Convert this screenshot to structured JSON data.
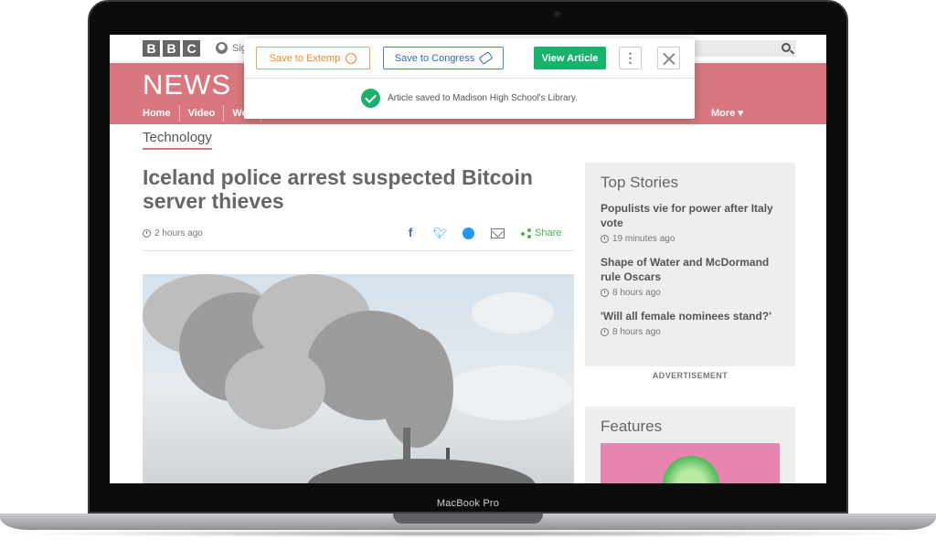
{
  "device": {
    "label": "MacBook Pro"
  },
  "site": {
    "logo_letters": [
      "B",
      "B",
      "C"
    ],
    "sign_in": "Sig",
    "section_title": "NEWS",
    "nav": [
      "Home",
      "Video",
      "Wor"
    ],
    "nav_more": "More ▾"
  },
  "article": {
    "section": "Technology",
    "headline": "Iceland police arrest suspected Bitcoin server thieves",
    "time": "2 hours ago",
    "share_label": "Share"
  },
  "sidebar": {
    "top_stories_title": "Top Stories",
    "stories": [
      {
        "title": "Populists vie for power after Italy vote",
        "time": "19 minutes ago"
      },
      {
        "title": "Shape of Water and McDormand rule Oscars",
        "time": "8 hours ago"
      },
      {
        "title": "'Will all female nominees stand?'",
        "time": "8 hours ago"
      }
    ],
    "advertisement": "ADVERTISEMENT",
    "features_title": "Features"
  },
  "extension": {
    "save_extemp": "Save to Extemp",
    "save_congress": "Save to Congress",
    "view_article": "View Article",
    "more": "⋮",
    "success_message": "Article saved to Madison High School's Library.",
    "colors": {
      "green": "#17b26b",
      "orange": "#f08a25",
      "blue": "#2f66c7"
    }
  },
  "icons": [
    "search-icon",
    "user-icon",
    "clock-icon",
    "facebook-icon",
    "twitter-icon",
    "messenger-icon",
    "email-icon",
    "share-icon",
    "alarm-clock-icon",
    "gavel-icon",
    "close-icon",
    "check-icon"
  ]
}
